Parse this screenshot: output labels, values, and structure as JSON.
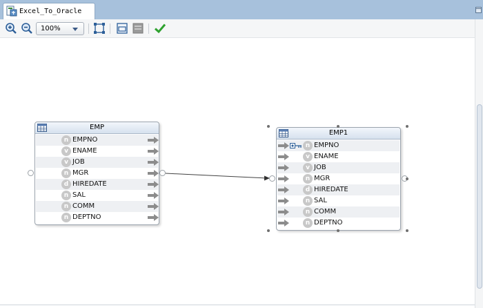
{
  "tab": {
    "title": "Excel_To_Oracle",
    "icon": "mapping-file-icon"
  },
  "toolbar": {
    "zoom_value": "100%",
    "buttons": [
      "zoom-in-icon",
      "zoom-out-icon",
      "fit-to-window-icon",
      "layout-icon",
      "properties-icon",
      "validate-check-icon"
    ]
  },
  "colors": {
    "tab_strip": "#a7c1dc",
    "header_gradient_end": "#d6e1ee",
    "badge": "#c8c8c8",
    "check": "#2ea12e"
  },
  "source": {
    "name": "EMP",
    "columns": [
      {
        "name": "EMPNO",
        "type": "n"
      },
      {
        "name": "ENAME",
        "type": "v"
      },
      {
        "name": "JOB",
        "type": "v"
      },
      {
        "name": "MGR",
        "type": "n"
      },
      {
        "name": "HIREDATE",
        "type": "d"
      },
      {
        "name": "SAL",
        "type": "n"
      },
      {
        "name": "COMM",
        "type": "n"
      },
      {
        "name": "DEPTNO",
        "type": "n"
      }
    ]
  },
  "target": {
    "name": "EMP1",
    "columns": [
      {
        "name": "EMPNO",
        "type": "n",
        "key": true
      },
      {
        "name": "ENAME",
        "type": "v"
      },
      {
        "name": "JOB",
        "type": "v"
      },
      {
        "name": "MGR",
        "type": "n"
      },
      {
        "name": "HIREDATE",
        "type": "d"
      },
      {
        "name": "SAL",
        "type": "n"
      },
      {
        "name": "COMM",
        "type": "n"
      },
      {
        "name": "DEPTNO",
        "type": "n"
      }
    ]
  }
}
